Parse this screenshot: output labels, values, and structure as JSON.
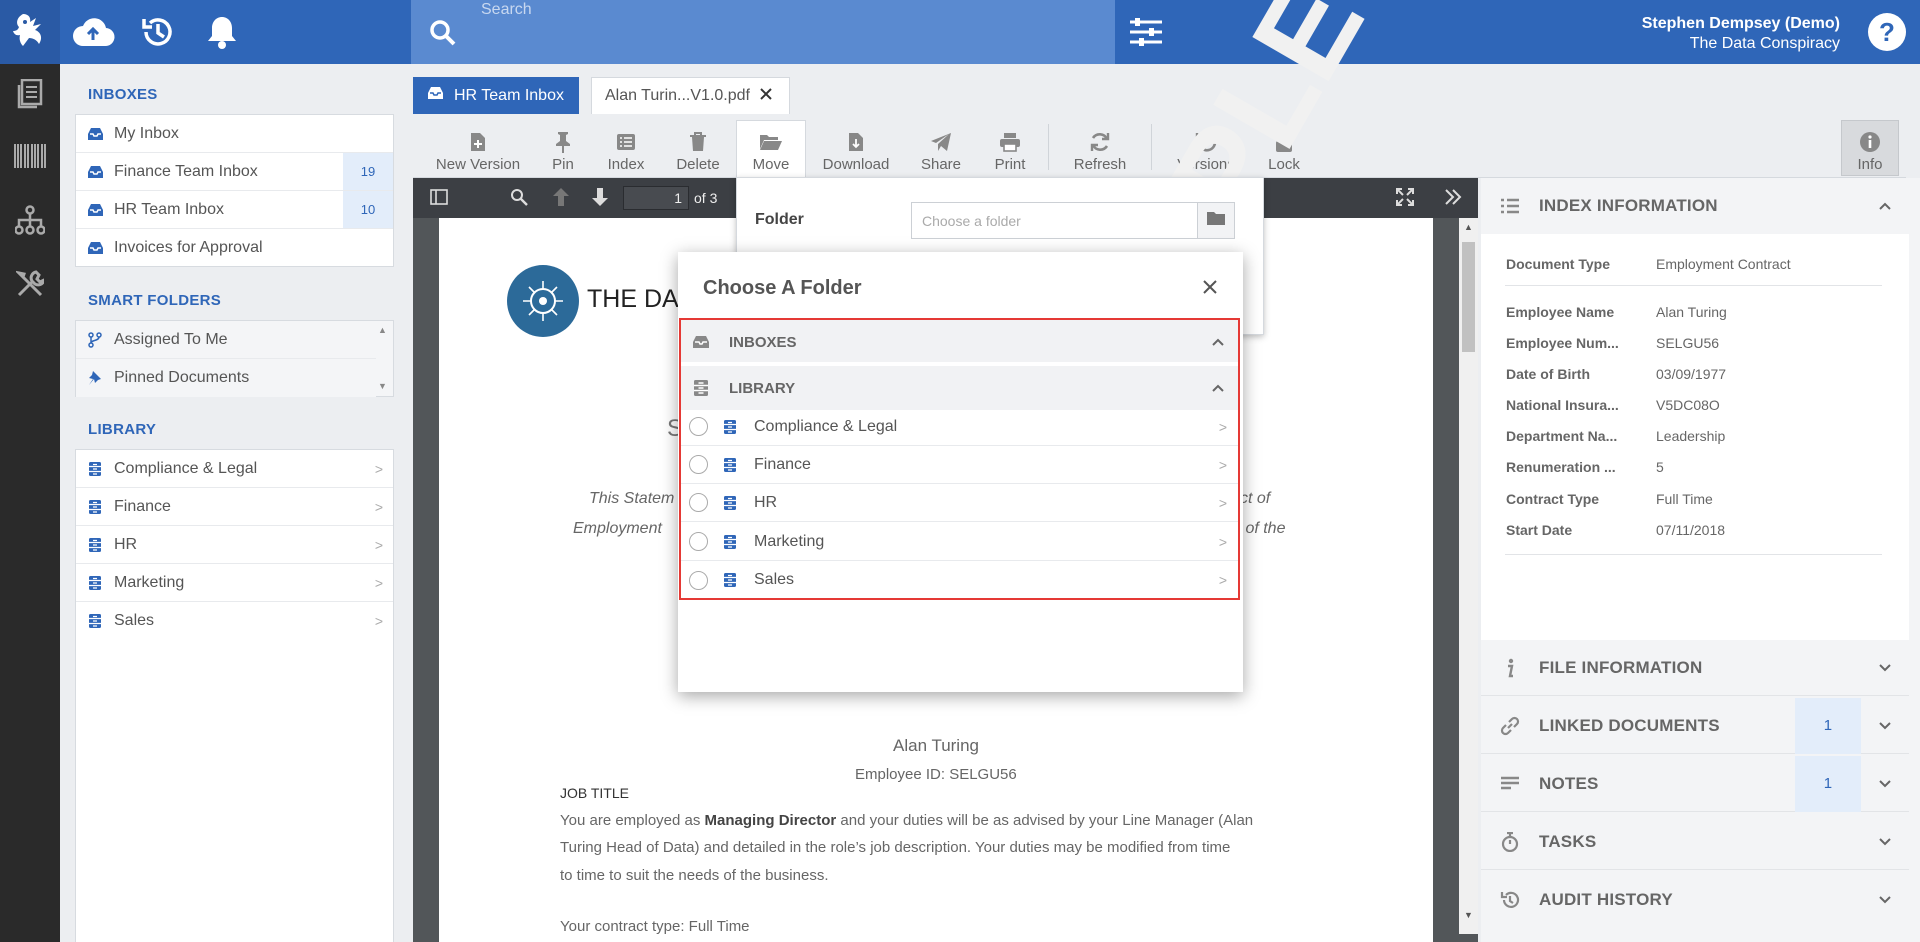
{
  "header": {
    "search_placeholder": "Search",
    "user_name": "Stephen Dempsey (Demo)",
    "org_name": "The Data Conspiracy",
    "help": "?"
  },
  "left": {
    "inboxes_title": "INBOXES",
    "inboxes": [
      {
        "label": "My Inbox",
        "count": ""
      },
      {
        "label": "Finance Team Inbox",
        "count": "19"
      },
      {
        "label": "HR Team Inbox",
        "count": "10"
      },
      {
        "label": "Invoices for Approval",
        "count": ""
      }
    ],
    "smart_title": "SMART FOLDERS",
    "smart": [
      {
        "label": "Assigned To Me"
      },
      {
        "label": "Pinned Documents"
      }
    ],
    "library_title": "LIBRARY",
    "library": [
      {
        "label": "Compliance & Legal"
      },
      {
        "label": "Finance"
      },
      {
        "label": "HR"
      },
      {
        "label": "Marketing"
      },
      {
        "label": "Sales"
      }
    ]
  },
  "tabs": {
    "inbox_tab": "HR Team Inbox",
    "doc_tab": "Alan Turin...V1.0.pdf"
  },
  "toolbar": {
    "new_version": "New Version",
    "pin": "Pin",
    "index": "Index",
    "delete": "Delete",
    "move": "Move",
    "download": "Download",
    "share": "Share",
    "print": "Print",
    "refresh": "Refresh",
    "versions": "Versions",
    "lock": "Lock",
    "info": "Info"
  },
  "pdf": {
    "page_input": "1",
    "page_total": "of 3",
    "logo_text": "THE DA",
    "heading_frag": "S",
    "intro_left_1": "This Statem",
    "intro_right_1": "ct of",
    "intro_left_2": "Employment",
    "intro_right_2": "s of the",
    "watermark": "SAMPLE DATA",
    "employee_name": "Alan Turing",
    "employee_id": "Employee ID: SELGU56",
    "job_title_heading": "JOB TITLE",
    "job_line1_a": "You are employed as ",
    "job_line1_b": "Managing Director",
    "job_line1_c": " and your duties will be as advised by your Line Manager (Alan",
    "job_line2": "Turing Head of Data) and detailed in the role’s job description. Your duties may be modified from time",
    "job_line3": "to time to suit the needs of the business.",
    "job_line4": "Your contract type: Full Time"
  },
  "move_popover": {
    "folder_label": "Folder",
    "folder_placeholder": "Choose a folder"
  },
  "dialog": {
    "title": "Choose A Folder",
    "inboxes_label": "INBOXES",
    "library_label": "LIBRARY",
    "folders": [
      {
        "label": "Compliance & Legal"
      },
      {
        "label": "Finance"
      },
      {
        "label": "HR"
      },
      {
        "label": "Marketing"
      },
      {
        "label": "Sales"
      }
    ]
  },
  "right": {
    "index_title": "INDEX INFORMATION",
    "fields": [
      {
        "key": "Document Type",
        "value": "Employment Contract"
      },
      {
        "key": "Employee Name",
        "value": "Alan Turing"
      },
      {
        "key": "Employee Num...",
        "value": "SELGU56"
      },
      {
        "key": "Date of Birth",
        "value": "03/09/1977"
      },
      {
        "key": "National Insura...",
        "value": "V5DC08O"
      },
      {
        "key": "Department Na...",
        "value": "Leadership"
      },
      {
        "key": "Renumeration ...",
        "value": "5"
      },
      {
        "key": "Contract Type",
        "value": "Full Time"
      },
      {
        "key": "Start Date",
        "value": "07/11/2018"
      }
    ],
    "file_info": "FILE INFORMATION",
    "linked_docs": "LINKED DOCUMENTS",
    "linked_count": "1",
    "notes": "NOTES",
    "notes_count": "1",
    "tasks": "TASKS",
    "audit": "AUDIT HISTORY"
  },
  "colors": {
    "primary": "#2f66b8",
    "highlight_border": "#e53935",
    "badge_bg": "#e3edfa"
  },
  "icons": [
    "logo-icon",
    "upload-cloud-icon",
    "history-icon",
    "bell-icon",
    "search-icon",
    "filter-sliders-icon",
    "help-icon",
    "documents-icon",
    "barcode-icon",
    "workflow-icon",
    "tools-icon",
    "inbox-tray-icon",
    "branch-icon",
    "pin-icon",
    "library-cabinet-icon",
    "chevron-right-icon",
    "chevron-up-icon",
    "chevron-down-icon",
    "close-icon",
    "folder-icon",
    "info-icon",
    "link-icon",
    "notes-icon",
    "stopwatch-icon",
    "audit-history-icon"
  ]
}
